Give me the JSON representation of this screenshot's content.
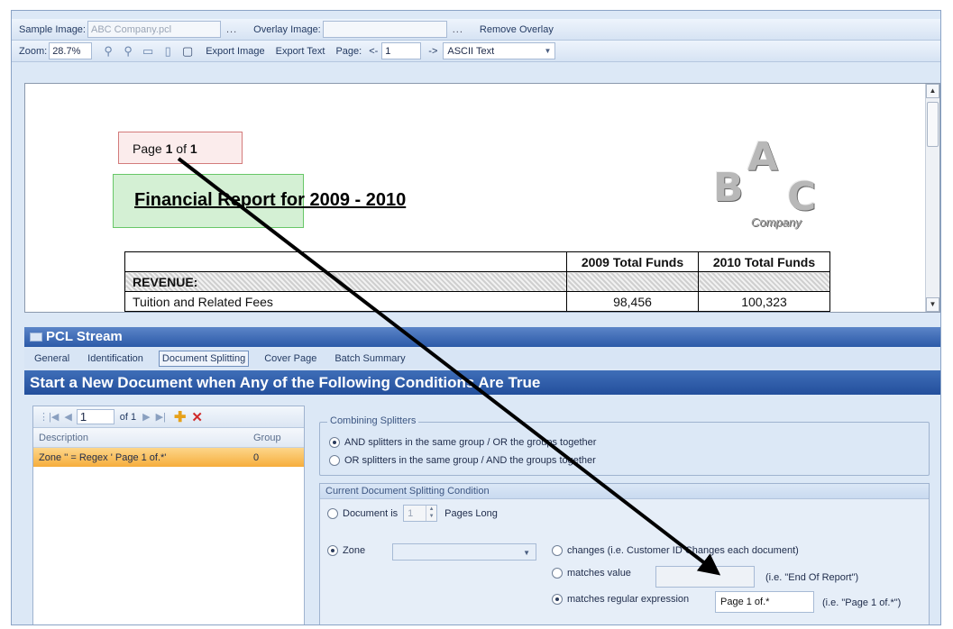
{
  "toolbar1": {
    "sample_label": "Sample Image:",
    "sample_value": "ABC Company.pcl",
    "browse1": "...",
    "overlay_label": "Overlay Image:",
    "overlay_value": "",
    "browse2": "...",
    "remove_overlay": "Remove Overlay"
  },
  "toolbar2": {
    "zoom_label": "Zoom:",
    "zoom_value": "28.7%",
    "export_image": "Export Image",
    "export_text": "Export Text",
    "page_label": "Page:",
    "prev": "<-",
    "page_value": "1",
    "next": "->",
    "mode_value": "ASCII Text"
  },
  "document": {
    "page_prefix": "Page ",
    "page_num": "1",
    "page_of": " of ",
    "page_total": "1",
    "title": "Financial Report for 2009 - 2010",
    "logo_letters": [
      "A",
      "B",
      "C"
    ],
    "logo_sub": "Company",
    "table": {
      "col1": "2009 Total Funds",
      "col2": "2010 Total Funds",
      "revenue": "REVENUE:",
      "row_label": "Tuition and Related Fees",
      "row_v1": "98,456",
      "row_v2": "100,323"
    }
  },
  "panel": {
    "title": "PCL Stream",
    "tabs": [
      "General",
      "Identification",
      "Document Splitting",
      "Cover Page",
      "Batch Summary"
    ],
    "banner": "Start a New Document when Any of the Following Conditions Are True"
  },
  "grid": {
    "nav_value": "1",
    "nav_of": "of 1",
    "col_desc": "Description",
    "col_group": "Group",
    "row_desc": "Zone '' = Regex ' Page 1 of.*'",
    "row_group": "0"
  },
  "combining": {
    "legend": "Combining Splitters",
    "opt1": "AND splitters in the same group / OR the groups together",
    "opt2": "OR splitters in the same group / AND the groups together"
  },
  "condition": {
    "title": "Current Document Splitting Condition",
    "doc_is": "Document is",
    "pages_value": "1",
    "pages_long": "Pages Long",
    "zone": "Zone",
    "changes": "changes (i.e. Customer ID Changes each document)",
    "matches_value": "matches value",
    "hint_value": "(i.e. \"End Of Report\")",
    "matches_regex": "matches regular expression",
    "regex_value": "Page 1 of.*",
    "hint_regex": "(i.e. \"Page 1 of.*\")"
  }
}
